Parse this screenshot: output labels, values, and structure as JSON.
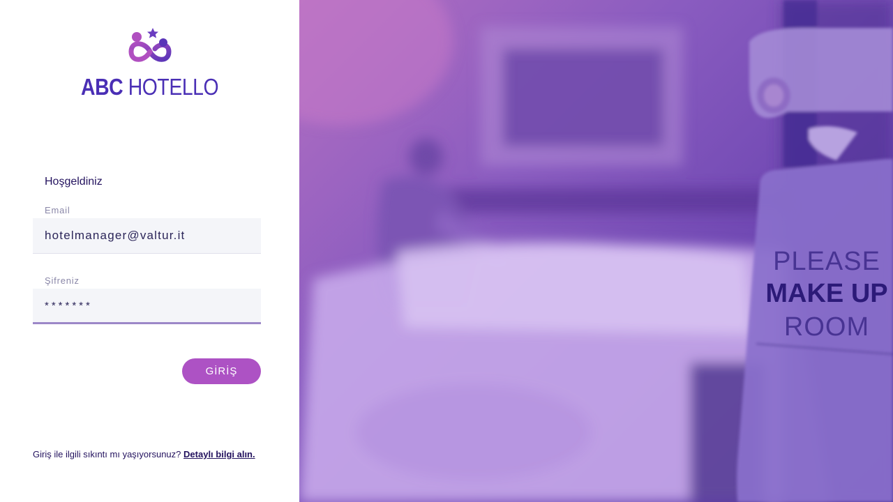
{
  "brand": {
    "bold": "ABC",
    "light": "HOTELLO",
    "logo_icon": "infinity-people-star-icon",
    "primary_color": "#4a2fb5",
    "accent_color": "#ad52c4"
  },
  "login": {
    "welcome": "Hoşgeldiniz",
    "email_label": "Email",
    "email_value": "hotelmanager@valtur.it",
    "password_label": "Şifreniz",
    "password_value": "*******",
    "submit_label": "GİRİŞ"
  },
  "help": {
    "text": "Giriş ile ilgili sıkıntı mı yaşıyorsunuz?",
    "link": "Detaylı bilgi alın."
  },
  "hero": {
    "image": "blurred-hotel-room-photo",
    "sign_line_1": "PLEASE",
    "sign_line_2": "MAKE UP",
    "sign_line_3": "ROOM"
  }
}
